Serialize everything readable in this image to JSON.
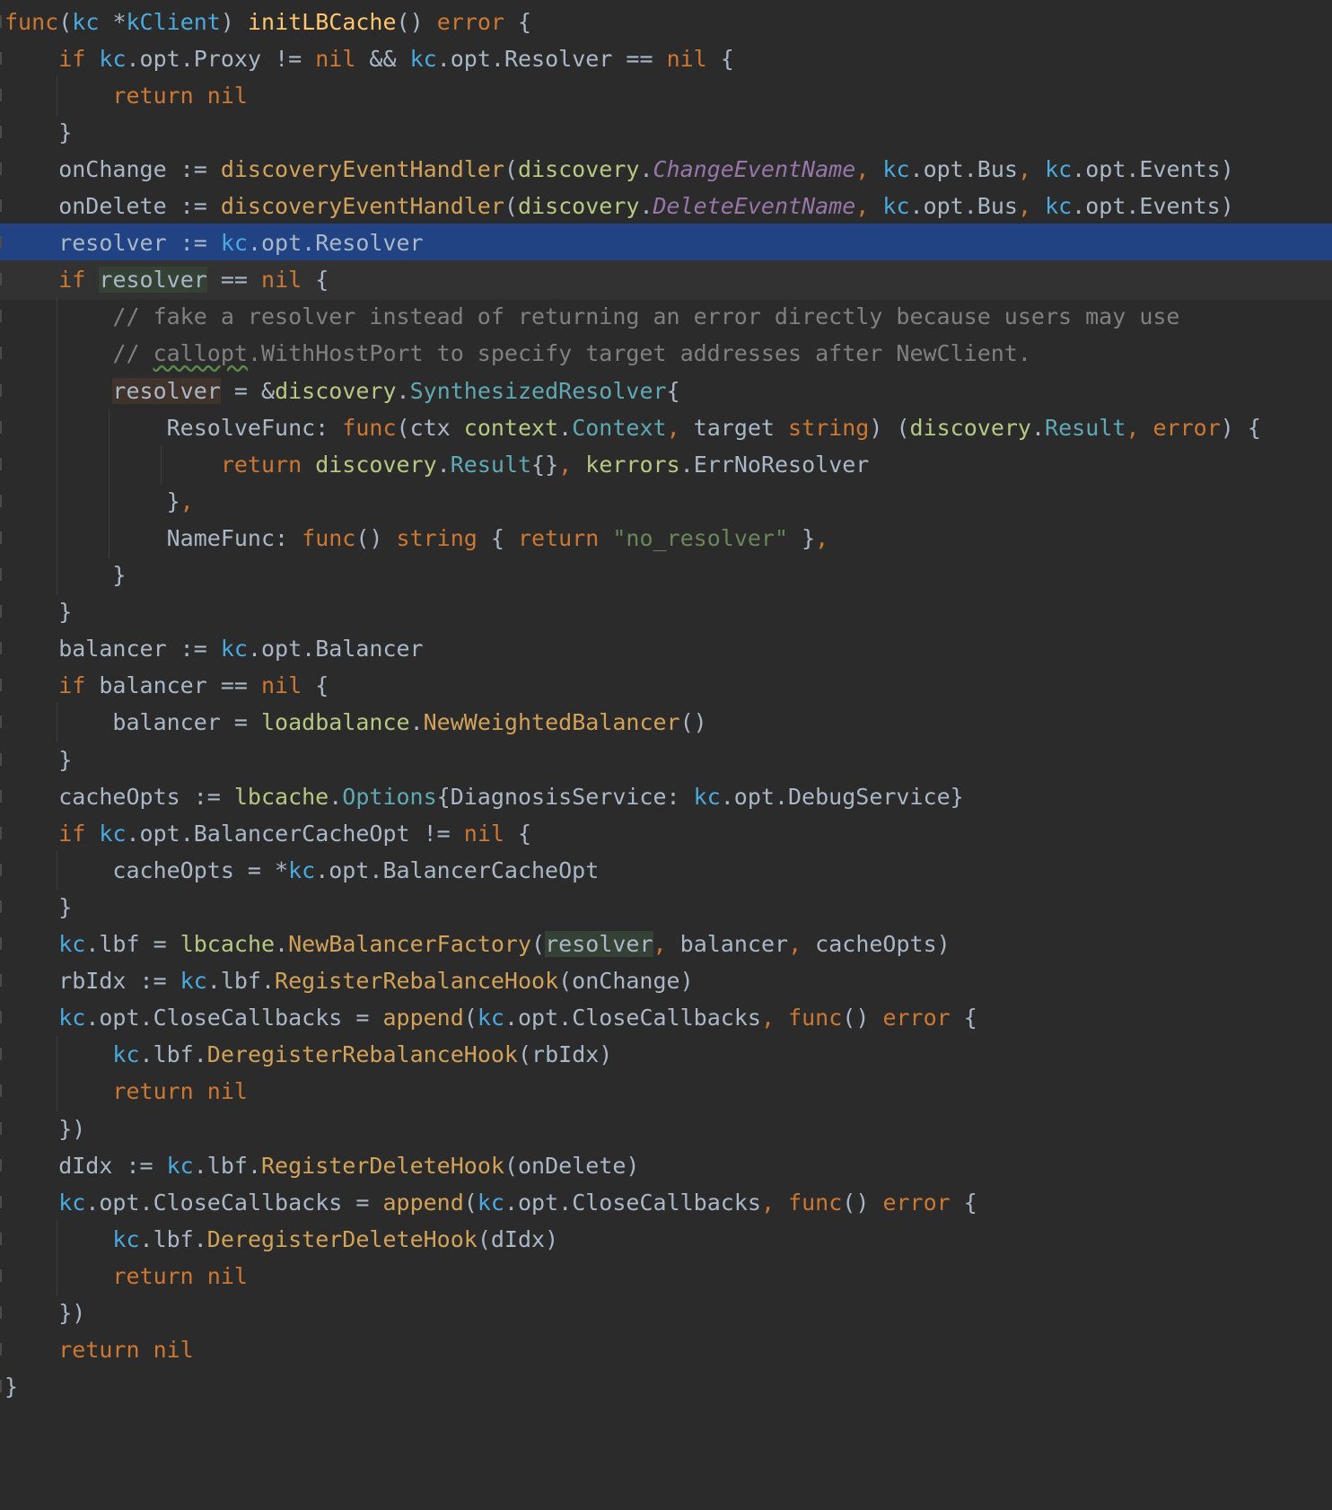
{
  "editor": {
    "lines": [
      {
        "segs": [
          [
            "kw",
            "func"
          ],
          [
            "",
            "("
          ],
          [
            "recv",
            "kc"
          ],
          [
            "",
            " *"
          ],
          [
            "recv",
            "kClient"
          ],
          [
            "",
            ") "
          ],
          [
            "fn",
            "initLBCache"
          ],
          [
            "",
            "() "
          ],
          [
            "kw",
            "error"
          ],
          [
            "",
            " {"
          ]
        ]
      },
      {
        "segs": [
          [
            "",
            "    "
          ],
          [
            "kw",
            "if"
          ],
          [
            "",
            " "
          ],
          [
            "recv",
            "kc"
          ],
          [
            "",
            ".opt.Proxy != "
          ],
          [
            "kw",
            "nil"
          ],
          [
            "",
            " && "
          ],
          [
            "recv",
            "kc"
          ],
          [
            "",
            ".opt.Resolver == "
          ],
          [
            "kw",
            "nil"
          ],
          [
            "",
            " {"
          ]
        ]
      },
      {
        "segs": [
          [
            "",
            "        "
          ],
          [
            "kw",
            "return"
          ],
          [
            "",
            " "
          ],
          [
            "kw",
            "nil"
          ]
        ]
      },
      {
        "segs": [
          [
            "",
            "    }"
          ]
        ]
      },
      {
        "segs": [
          [
            "",
            "    onChange := "
          ],
          [
            "call",
            "discoveryEventHandler"
          ],
          [
            "",
            "("
          ],
          [
            "pkg",
            "discovery"
          ],
          [
            "",
            "."
          ],
          [
            "cst",
            "ChangeEventName"
          ],
          [
            "kw",
            ","
          ],
          [
            "",
            " "
          ],
          [
            "recv",
            "kc"
          ],
          [
            "",
            ".opt.Bus"
          ],
          [
            "kw",
            ","
          ],
          [
            "",
            " "
          ],
          [
            "recv",
            "kc"
          ],
          [
            "",
            ".opt.Events)"
          ]
        ]
      },
      {
        "segs": [
          [
            "",
            "    onDelete := "
          ],
          [
            "call",
            "discoveryEventHandler"
          ],
          [
            "",
            "("
          ],
          [
            "pkg",
            "discovery"
          ],
          [
            "",
            "."
          ],
          [
            "cst",
            "DeleteEventName"
          ],
          [
            "kw",
            ","
          ],
          [
            "",
            " "
          ],
          [
            "recv",
            "kc"
          ],
          [
            "",
            ".opt.Bus"
          ],
          [
            "kw",
            ","
          ],
          [
            "",
            " "
          ],
          [
            "recv",
            "kc"
          ],
          [
            "",
            ".opt.Events)"
          ]
        ]
      },
      {
        "segs": [
          [
            "",
            "    resolver := "
          ],
          [
            "recv",
            "kc"
          ],
          [
            "",
            ".opt.Resolver"
          ]
        ]
      },
      {
        "segs": [
          [
            "",
            "    "
          ],
          [
            "kw",
            "if"
          ],
          [
            "",
            " "
          ],
          [
            "hl",
            "resolver"
          ],
          [
            "",
            " == "
          ],
          [
            "kw",
            "nil"
          ],
          [
            "",
            " {"
          ]
        ]
      },
      {
        "segs": [
          [
            "",
            "        "
          ],
          [
            "cmt",
            "// fake a resolver instead of returning an error directly because users may use"
          ]
        ]
      },
      {
        "segs": [
          [
            "",
            "        "
          ],
          [
            "cmt",
            "// "
          ],
          [
            "cmt squig",
            "callopt"
          ],
          [
            "cmt",
            ".WithHostPort to specify target addresses after NewClient."
          ]
        ]
      },
      {
        "segs": [
          [
            "",
            "        "
          ],
          [
            "hlw",
            "resolver"
          ],
          [
            "",
            " = &"
          ],
          [
            "pkg",
            "discovery"
          ],
          [
            "",
            "."
          ],
          [
            "ty",
            "SynthesizedResolver"
          ],
          [
            "",
            "{"
          ]
        ]
      },
      {
        "segs": [
          [
            "",
            "            ResolveFunc: "
          ],
          [
            "kw",
            "func"
          ],
          [
            "",
            "(ctx "
          ],
          [
            "pkg",
            "context"
          ],
          [
            "",
            "."
          ],
          [
            "ty",
            "Context"
          ],
          [
            "kw",
            ","
          ],
          [
            "",
            " target "
          ],
          [
            "kw",
            "string"
          ],
          [
            "",
            ") ("
          ],
          [
            "pkg",
            "discovery"
          ],
          [
            "",
            "."
          ],
          [
            "ty",
            "Result"
          ],
          [
            "kw",
            ","
          ],
          [
            "",
            " "
          ],
          [
            "kw",
            "error"
          ],
          [
            "",
            ") {"
          ]
        ]
      },
      {
        "segs": [
          [
            "",
            "                "
          ],
          [
            "kw",
            "return"
          ],
          [
            "",
            " "
          ],
          [
            "pkg",
            "discovery"
          ],
          [
            "",
            "."
          ],
          [
            "ty",
            "Result"
          ],
          [
            "",
            "{}"
          ],
          [
            "kw",
            ","
          ],
          [
            "",
            " "
          ],
          [
            "pkg",
            "kerrors"
          ],
          [
            "",
            ".ErrNoResolver"
          ]
        ]
      },
      {
        "segs": [
          [
            "",
            "            }"
          ],
          [
            "kw",
            ","
          ]
        ]
      },
      {
        "segs": [
          [
            "",
            "            NameFunc: "
          ],
          [
            "kw",
            "func"
          ],
          [
            "",
            "() "
          ],
          [
            "kw",
            "string"
          ],
          [
            "",
            " { "
          ],
          [
            "kw",
            "return"
          ],
          [
            "",
            " "
          ],
          [
            "str",
            "\"no_resolver\""
          ],
          [
            "",
            " }"
          ],
          [
            "kw",
            ","
          ]
        ]
      },
      {
        "segs": [
          [
            "",
            "        }"
          ]
        ]
      },
      {
        "segs": [
          [
            "",
            "    }"
          ]
        ]
      },
      {
        "segs": [
          [
            "",
            "    balancer := "
          ],
          [
            "recv",
            "kc"
          ],
          [
            "",
            ".opt.Balancer"
          ]
        ]
      },
      {
        "segs": [
          [
            "",
            "    "
          ],
          [
            "kw",
            "if"
          ],
          [
            "",
            " balancer == "
          ],
          [
            "kw",
            "nil"
          ],
          [
            "",
            " {"
          ]
        ]
      },
      {
        "segs": [
          [
            "",
            "        balancer = "
          ],
          [
            "pkg",
            "loadbalance"
          ],
          [
            "",
            "."
          ],
          [
            "call",
            "NewWeightedBalancer"
          ],
          [
            "",
            "()"
          ]
        ]
      },
      {
        "segs": [
          [
            "",
            "    }"
          ]
        ]
      },
      {
        "segs": [
          [
            "",
            "    cacheOpts := "
          ],
          [
            "pkg",
            "lbcache"
          ],
          [
            "",
            "."
          ],
          [
            "ty",
            "Options"
          ],
          [
            "",
            "{DiagnosisService: "
          ],
          [
            "recv",
            "kc"
          ],
          [
            "",
            ".opt.DebugService}"
          ]
        ]
      },
      {
        "segs": [
          [
            "",
            "    "
          ],
          [
            "kw",
            "if"
          ],
          [
            "",
            " "
          ],
          [
            "recv",
            "kc"
          ],
          [
            "",
            ".opt.BalancerCacheOpt != "
          ],
          [
            "kw",
            "nil"
          ],
          [
            "",
            " {"
          ]
        ]
      },
      {
        "segs": [
          [
            "",
            "        cacheOpts = *"
          ],
          [
            "recv",
            "kc"
          ],
          [
            "",
            ".opt.BalancerCacheOpt"
          ]
        ]
      },
      {
        "segs": [
          [
            "",
            "    }"
          ]
        ]
      },
      {
        "segs": [
          [
            "",
            "    "
          ],
          [
            "recv",
            "kc"
          ],
          [
            "",
            ".lbf = "
          ],
          [
            "pkg",
            "lbcache"
          ],
          [
            "",
            "."
          ],
          [
            "call",
            "NewBalancerFactory"
          ],
          [
            "",
            "("
          ],
          [
            "hl",
            "resolver"
          ],
          [
            "kw",
            ","
          ],
          [
            "",
            " balancer"
          ],
          [
            "kw",
            ","
          ],
          [
            "",
            " cacheOpts)"
          ]
        ]
      },
      {
        "segs": [
          [
            "",
            "    rbIdx := "
          ],
          [
            "recv",
            "kc"
          ],
          [
            "",
            ".lbf."
          ],
          [
            "call",
            "RegisterRebalanceHook"
          ],
          [
            "",
            "(onChange)"
          ]
        ]
      },
      {
        "segs": [
          [
            "",
            "    "
          ],
          [
            "recv",
            "kc"
          ],
          [
            "",
            ".opt.CloseCallbacks = "
          ],
          [
            "call",
            "append"
          ],
          [
            "",
            "("
          ],
          [
            "recv",
            "kc"
          ],
          [
            "",
            ".opt.CloseCallbacks"
          ],
          [
            "kw",
            ","
          ],
          [
            "",
            " "
          ],
          [
            "kw",
            "func"
          ],
          [
            "",
            "() "
          ],
          [
            "kw",
            "error"
          ],
          [
            "",
            " {"
          ]
        ]
      },
      {
        "segs": [
          [
            "",
            "        "
          ],
          [
            "recv",
            "kc"
          ],
          [
            "",
            ".lbf."
          ],
          [
            "call",
            "DeregisterRebalanceHook"
          ],
          [
            "",
            "(rbIdx)"
          ]
        ]
      },
      {
        "segs": [
          [
            "",
            "        "
          ],
          [
            "kw",
            "return"
          ],
          [
            "",
            " "
          ],
          [
            "kw",
            "nil"
          ]
        ]
      },
      {
        "segs": [
          [
            "",
            "    })"
          ]
        ]
      },
      {
        "segs": [
          [
            "",
            "    dIdx := "
          ],
          [
            "recv",
            "kc"
          ],
          [
            "",
            ".lbf."
          ],
          [
            "call",
            "RegisterDeleteHook"
          ],
          [
            "",
            "(onDelete)"
          ]
        ]
      },
      {
        "segs": [
          [
            "",
            "    "
          ],
          [
            "recv",
            "kc"
          ],
          [
            "",
            ".opt.CloseCallbacks = "
          ],
          [
            "call",
            "append"
          ],
          [
            "",
            "("
          ],
          [
            "recv",
            "kc"
          ],
          [
            "",
            ".opt.CloseCallbacks"
          ],
          [
            "kw",
            ","
          ],
          [
            "",
            " "
          ],
          [
            "kw",
            "func"
          ],
          [
            "",
            "() "
          ],
          [
            "kw",
            "error"
          ],
          [
            "",
            " {"
          ]
        ]
      },
      {
        "segs": [
          [
            "",
            "        "
          ],
          [
            "recv",
            "kc"
          ],
          [
            "",
            ".lbf."
          ],
          [
            "call",
            "DeregisterDeleteHook"
          ],
          [
            "",
            "(dIdx)"
          ]
        ]
      },
      {
        "segs": [
          [
            "",
            "        "
          ],
          [
            "kw",
            "return"
          ],
          [
            "",
            " "
          ],
          [
            "kw",
            "nil"
          ]
        ]
      },
      {
        "segs": [
          [
            "",
            "    })"
          ]
        ]
      },
      {
        "segs": [
          [
            "",
            "    "
          ],
          [
            "kw",
            "return"
          ],
          [
            "",
            " "
          ],
          [
            "kw",
            "nil"
          ]
        ]
      },
      {
        "segs": [
          [
            "",
            "}"
          ]
        ]
      }
    ],
    "selected_line": 7,
    "caret_line": 8,
    "colors": {
      "background": "#2b2b2b",
      "selection": "#214283",
      "keyword": "#cc7832",
      "function": "#ffc66d",
      "receiver": "#4aa9dd",
      "constant": "#9876aa",
      "string": "#6a8759",
      "comment": "#808080"
    }
  }
}
